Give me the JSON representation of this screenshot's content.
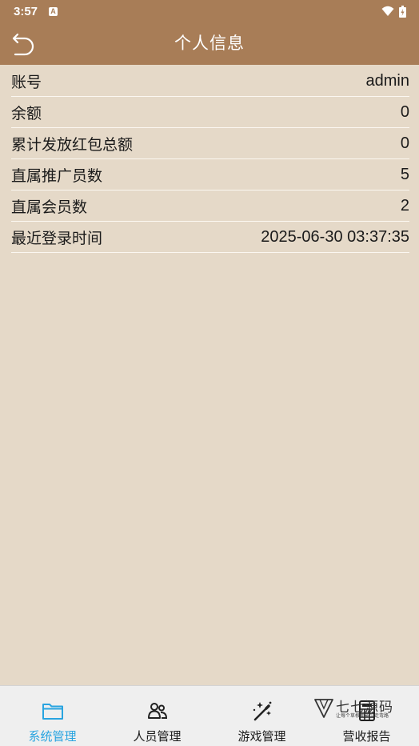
{
  "status_bar": {
    "time": "3:57",
    "notification_badge": "A"
  },
  "header": {
    "title": "个人信息"
  },
  "info_rows": [
    {
      "label": "账号",
      "value": "admin"
    },
    {
      "label": "余额",
      "value": "0"
    },
    {
      "label": "累计发放红包总额",
      "value": "0"
    },
    {
      "label": "直属推广员数",
      "value": "5"
    },
    {
      "label": "直属会员数",
      "value": "2"
    },
    {
      "label": "最近登录时间",
      "value": "2025-06-30 03:37:35"
    }
  ],
  "tabs": [
    {
      "label": "系统管理",
      "icon": "folder-icon",
      "active": true
    },
    {
      "label": "人员管理",
      "icon": "people-icon",
      "active": false
    },
    {
      "label": "游戏管理",
      "icon": "magic-wand-icon",
      "active": false
    },
    {
      "label": "营收报告",
      "icon": "calculator-icon",
      "active": false
    }
  ],
  "watermark": {
    "title": "七七源码",
    "subtitle": "让每个草根都能少走弯路"
  },
  "colors": {
    "header": "#a87d57",
    "background": "#e5d9c8",
    "tab_active": "#29a4e0",
    "tab_bar": "#efefef"
  }
}
